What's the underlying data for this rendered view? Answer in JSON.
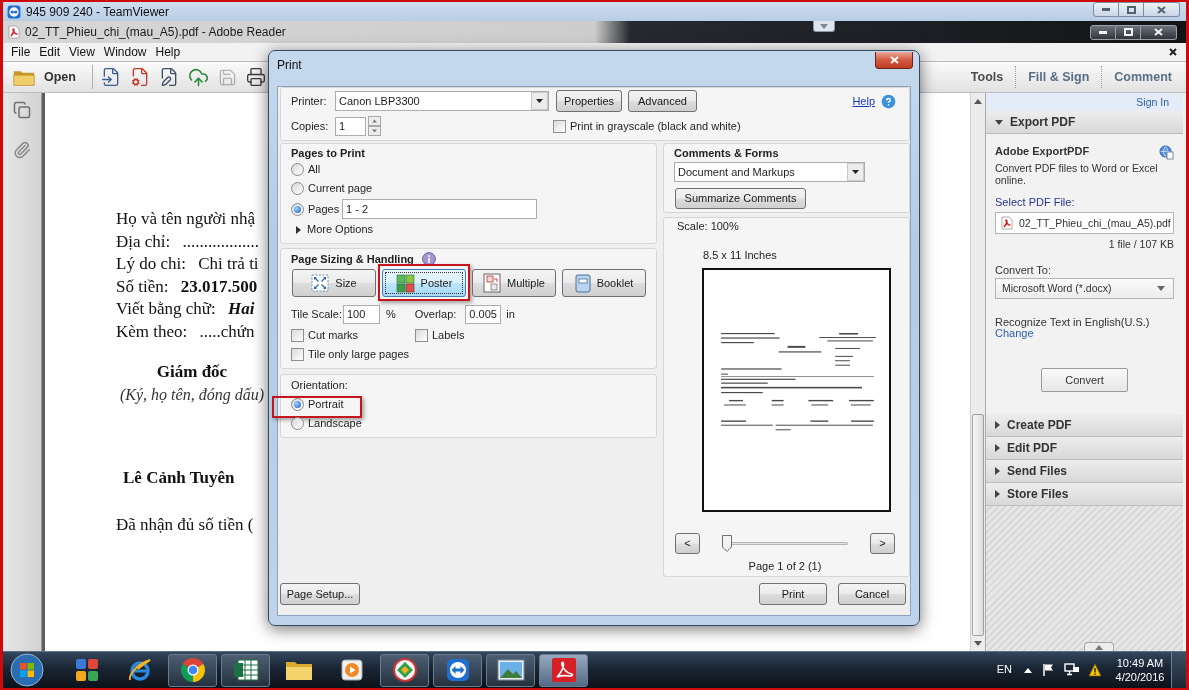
{
  "teamviewer": {
    "title": "945 909 240 - TeamViewer"
  },
  "reader": {
    "title": "02_TT_Phieu_chi_(mau_A5).pdf - Adobe Reader",
    "menu": [
      "File",
      "Edit",
      "View",
      "Window",
      "Help"
    ],
    "toolbar": {
      "open": "Open",
      "buttons": [
        {
          "kind": "create",
          "disabled": false
        },
        {
          "kind": "pdf_settings",
          "disabled": false
        },
        {
          "kind": "edit",
          "disabled": false
        },
        {
          "kind": "upload",
          "disabled": false
        },
        {
          "kind": "save",
          "disabled": true
        },
        {
          "kind": "print",
          "disabled": false
        }
      ],
      "panes": [
        {
          "label": "Tools",
          "color": "#4b4b4b"
        },
        {
          "label": "Fill & Sign",
          "color": "#5a6e86"
        },
        {
          "label": "Comment",
          "color": "#5a6e86"
        }
      ]
    }
  },
  "document": {
    "lines": [
      {
        "label": "Họ và tên người nhậ"
      },
      {
        "label": "Địa chỉ:",
        "value": "..................",
        "bold": false,
        "italic": false
      },
      {
        "label": "Lý do chi:",
        "value": "Chi trả ti",
        "bold": false,
        "italic": false
      },
      {
        "label": "Số tiền:",
        "value": "23.017.500",
        "bold": true,
        "italic": false
      },
      {
        "label": "Viết bằng chữ:",
        "value": "Hai",
        "bold": true,
        "italic": true
      },
      {
        "label": "Kèm theo:",
        "value": ".....chứn",
        "bold": false,
        "italic": false
      }
    ],
    "signature_title": "Giám đốc",
    "signature_hint": "(Ký, họ tên, đóng dấu)",
    "signer": "Lê Cảnh Tuyên",
    "receipt": "Đã nhận đủ số tiền ("
  },
  "right_panel": {
    "sign_in": "Sign In",
    "sections": [
      {
        "title": "Export PDF",
        "expanded": true,
        "content": {
          "heading": "Adobe ExportPDF",
          "description": "Convert PDF files to Word or Excel online.",
          "select_label": "Select PDF File:",
          "file": "02_TT_Phieu_chi_(mau_A5).pdf",
          "file_info": "1 file / 107 KB",
          "convert_to_label": "Convert To:",
          "convert_to": "Microsoft Word (*.docx)",
          "ocr_note": "Recognize Text in English(U.S.)",
          "change_link": "Change",
          "convert_button": "Convert"
        }
      },
      {
        "title": "Create PDF",
        "expanded": false
      },
      {
        "title": "Edit PDF",
        "expanded": false
      },
      {
        "title": "Send Files",
        "expanded": false
      },
      {
        "title": "Store Files",
        "expanded": false
      }
    ]
  },
  "print_dialog": {
    "title": "Print",
    "printer_label": "Printer:",
    "printer": "Canon LBP3300",
    "properties": "Properties",
    "advanced": "Advanced",
    "help": "Help",
    "copies_label": "Copies:",
    "copies": "1",
    "grayscale": {
      "label": "Print in grayscale (black and white)",
      "checked": false
    },
    "pages_to_print": {
      "title": "Pages to Print",
      "options": [
        {
          "label": "All",
          "selected": false
        },
        {
          "label": "Current page",
          "selected": false
        },
        {
          "label": "Pages",
          "selected": true,
          "range": "1 - 2"
        }
      ],
      "more_options": {
        "label": "More Options",
        "expanded": false
      }
    },
    "page_sizing": {
      "title": "Page Sizing & Handling",
      "modes": [
        {
          "kind": "size",
          "label": "Size",
          "selected": false,
          "highlighted": false
        },
        {
          "kind": "poster",
          "label": "Poster",
          "selected": true,
          "highlighted": true
        },
        {
          "kind": "multiple",
          "label": "Multiple",
          "selected": false,
          "highlighted": false
        },
        {
          "kind": "booklet",
          "label": "Booklet",
          "selected": false,
          "highlighted": false
        }
      ],
      "tile_scale_label": "Tile Scale:",
      "tile_scale": "100",
      "tile_scale_unit": "%",
      "overlap_label": "Overlap:",
      "overlap": "0.005",
      "overlap_unit": "in",
      "options": [
        {
          "label": "Cut marks",
          "checked": false
        },
        {
          "label": "Labels",
          "checked": false
        },
        {
          "label": "Tile only large pages",
          "checked": false
        }
      ]
    },
    "orientation": {
      "title": "Orientation:",
      "options": [
        {
          "label": "Portrait",
          "selected": true,
          "highlighted": true
        },
        {
          "label": "Landscape",
          "selected": false,
          "highlighted": false
        }
      ]
    },
    "comments_forms": {
      "title": "Comments & Forms",
      "value": "Document and Markups",
      "summarize": "Summarize Comments"
    },
    "preview": {
      "scale": "Scale: 100%",
      "paper": "8.5 x 11 Inches",
      "prev": "<",
      "next": ">",
      "page_slider": {
        "level": 0
      },
      "page_info": "Page 1 of 2 (1)"
    },
    "page_setup": "Page Setup...",
    "print": "Print",
    "cancel": "Cancel"
  },
  "taskbar": {
    "apps": [
      {
        "kind": "tiles",
        "running": false,
        "selected": false
      },
      {
        "kind": "orbit",
        "running": false,
        "selected": false
      },
      {
        "kind": "segmented",
        "running": true,
        "selected": false
      },
      {
        "kind": "spreadsheet",
        "running": true,
        "selected": false
      },
      {
        "kind": "folder",
        "running": false,
        "selected": false
      },
      {
        "kind": "play",
        "running": false,
        "selected": false
      },
      {
        "kind": "diamond",
        "running": true,
        "selected": false
      },
      {
        "kind": "double_arrow",
        "running": true,
        "selected": false
      },
      {
        "kind": "picture",
        "running": true,
        "selected": false
      },
      {
        "kind": "swirl",
        "running": true,
        "selected": true
      }
    ],
    "language": "EN",
    "time": "10:49 AM",
    "date": "4/20/2016"
  }
}
